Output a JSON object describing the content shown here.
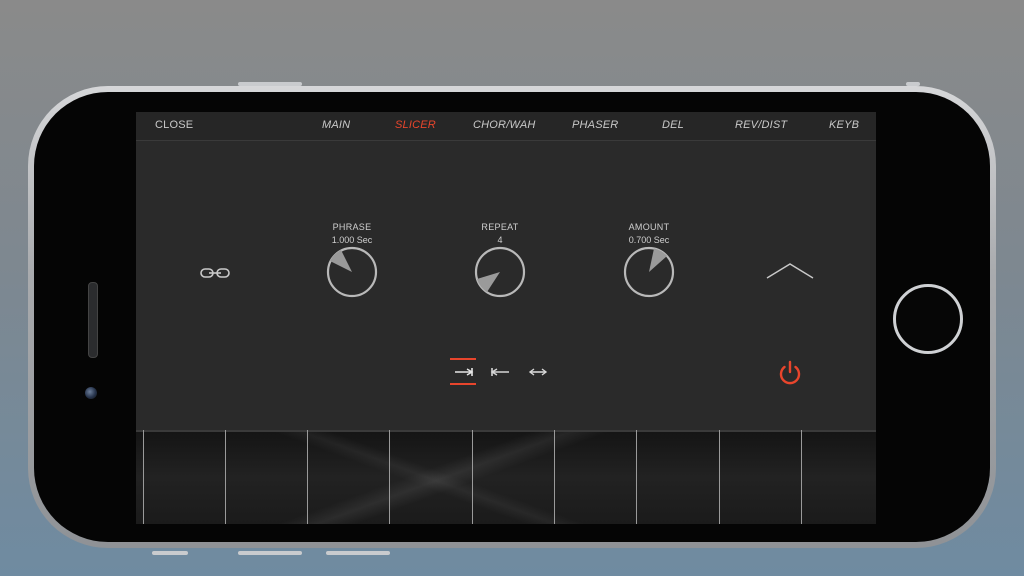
{
  "tabs": {
    "close": "CLOSE",
    "main": "MAIN",
    "slicer": "SLICER",
    "chor_wah": "CHOR/WAH",
    "phaser": "PHASER",
    "del": "DEL",
    "rev_dist": "REV/DIST",
    "keyb": "KEYB",
    "active": "SLICER"
  },
  "controls": {
    "phrase": {
      "label": "PHRASE",
      "value": "1.000 Sec"
    },
    "repeat": {
      "label": "REPEAT",
      "value": "4"
    },
    "amount": {
      "label": "AMOUNT",
      "value": "0.700 Sec"
    }
  },
  "direction": {
    "options": [
      "forward",
      "backward",
      "both"
    ],
    "selected": "forward"
  },
  "icons": {
    "link": "link-icon",
    "collapse": "chevron-up-icon",
    "power": "power-icon",
    "forward": "arrow-right-icon",
    "backward": "arrow-left-icon",
    "both": "arrow-both-icon"
  },
  "colors": {
    "accent": "#e8452c",
    "panel": "#2a2a2a",
    "text": "#c9c9c9"
  }
}
